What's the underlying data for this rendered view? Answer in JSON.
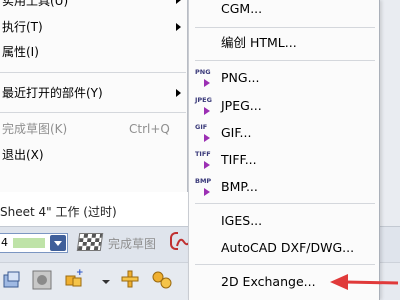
{
  "left_menu": {
    "items": [
      {
        "label": "实用工具(U)",
        "has_submenu": true
      },
      {
        "label": "执行(T)",
        "has_submenu": true
      },
      {
        "label": "属性(I)",
        "has_submenu": false
      },
      {
        "label": "最近打开的部件(Y)",
        "has_submenu": true
      },
      {
        "label": "完成草图(K)",
        "shortcut": "Ctrl+Q",
        "disabled": true
      },
      {
        "label": "退出(X)",
        "has_submenu": false
      }
    ]
  },
  "status": {
    "text": "Sheet 4\" 工作 (过时)"
  },
  "toolbar": {
    "combo_value": "4",
    "finish_sketch_label": "完成草图"
  },
  "export_submenu": {
    "items": [
      {
        "label": "CGM...",
        "mnemonic": "C"
      },
      {
        "label": "编创 HTML...",
        "mnemonic": "H"
      },
      {
        "label": "PNG...",
        "icon": "PNG",
        "mnemonic": "N"
      },
      {
        "label": "JPEG...",
        "icon": "JPEG",
        "mnemonic": "J"
      },
      {
        "label": "GIF...",
        "icon": "GIF",
        "mnemonic": "G"
      },
      {
        "label": "TIFF...",
        "icon": "TIFF",
        "mnemonic": "T"
      },
      {
        "label": "BMP...",
        "icon": "BMP",
        "mnemonic": "B"
      },
      {
        "label": "IGES...",
        "mnemonic": "I"
      },
      {
        "label": "AutoCAD DXF/DWG...",
        "mnemonic": ""
      },
      {
        "label": "2D Exchange...",
        "mnemonic": "2"
      }
    ]
  },
  "colors": {
    "annotation_arrow": "#e03a3a",
    "icon_arrow": "#9b2fb3"
  }
}
